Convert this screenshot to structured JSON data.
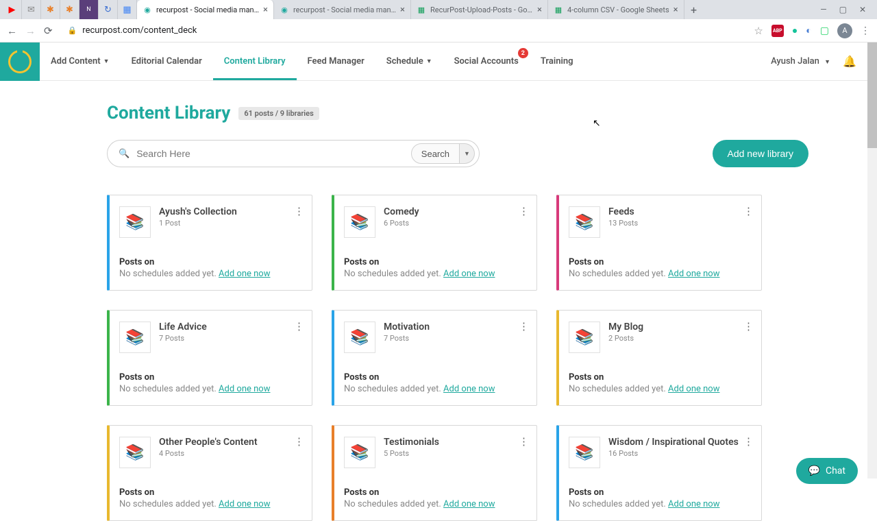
{
  "browser": {
    "tabs": [
      {
        "title": "recurpost - Social media manag...",
        "active": true
      },
      {
        "title": "recurpost - Social media manag...",
        "active": false
      },
      {
        "title": "RecurPost-Upload-Posts - Goog...",
        "active": false
      },
      {
        "title": "4-column CSV - Google Sheets",
        "active": false
      }
    ],
    "url": "recurpost.com/content_deck",
    "avatar": "A"
  },
  "nav": {
    "items": [
      {
        "label": "Add Content",
        "caret": true
      },
      {
        "label": "Editorial Calendar"
      },
      {
        "label": "Content Library",
        "active": true
      },
      {
        "label": "Feed Manager"
      },
      {
        "label": "Schedule",
        "caret": true
      },
      {
        "label": "Social Accounts",
        "badge": "2"
      },
      {
        "label": "Training"
      }
    ],
    "user": "Ayush Jalan"
  },
  "page": {
    "title": "Content Library",
    "count_pill": "61 posts / 9 libraries",
    "search_placeholder": "Search Here",
    "search_btn": "Search",
    "add_btn": "Add new library"
  },
  "cards": [
    {
      "title": "Ayush's Collection",
      "sub": "1 Post",
      "color": "blue"
    },
    {
      "title": "Comedy",
      "sub": "6 Posts",
      "color": "green"
    },
    {
      "title": "Feeds",
      "sub": "13 Posts",
      "color": "pink"
    },
    {
      "title": "Life Advice",
      "sub": "7 Posts",
      "color": "green"
    },
    {
      "title": "Motivation",
      "sub": "7 Posts",
      "color": "blue"
    },
    {
      "title": "My Blog",
      "sub": "2 Posts",
      "color": "yellow"
    },
    {
      "title": "Other People's Content",
      "sub": "4 Posts",
      "color": "yellow"
    },
    {
      "title": "Testimonials",
      "sub": "5 Posts",
      "color": "orange"
    },
    {
      "title": "Wisdom / Inspirational Quotes",
      "sub": "16 Posts",
      "color": "blue"
    }
  ],
  "card_labels": {
    "posts_on": "Posts on",
    "no_sched": "No schedules added yet. ",
    "add_link": "Add one now"
  },
  "chat": "Chat"
}
